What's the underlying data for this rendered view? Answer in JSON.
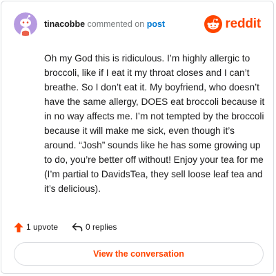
{
  "header": {
    "author": "tinacobbe",
    "action_text": "commented on",
    "post_link_label": "post",
    "brand_name": "reddit"
  },
  "comment": {
    "body": "Oh my God this is ridiculous. I’m highly allergic to broccoli, like if I eat it my throat closes and I can’t breathe. So I don’t eat it. My boyfriend, who doesn’t have the same allergy, DOES eat broccoli because it in no way affects me. I’m not tempted by the broccoli because it will make me sick, even though it’s around. “Josh” sounds like he has some growing up to do, you’re better off without! Enjoy your tea for me (I’m partial to DavidsTea, they sell loose leaf tea and it’s delicious)."
  },
  "stats": {
    "upvotes_label": "1 upvote",
    "replies_label": "0 replies"
  },
  "cta": {
    "label": "View the conversation"
  },
  "colors": {
    "brand": "#ff4500",
    "link": "#0079d3",
    "avatar_bg": "#b69ae0",
    "text": "#1a1a1b",
    "meta": "#787c7e"
  },
  "icons": {
    "upvote": "upvote-arrow-icon",
    "reply": "reply-arrow-icon",
    "brand": "reddit-snoo-logo",
    "avatar": "snoo-avatar"
  }
}
